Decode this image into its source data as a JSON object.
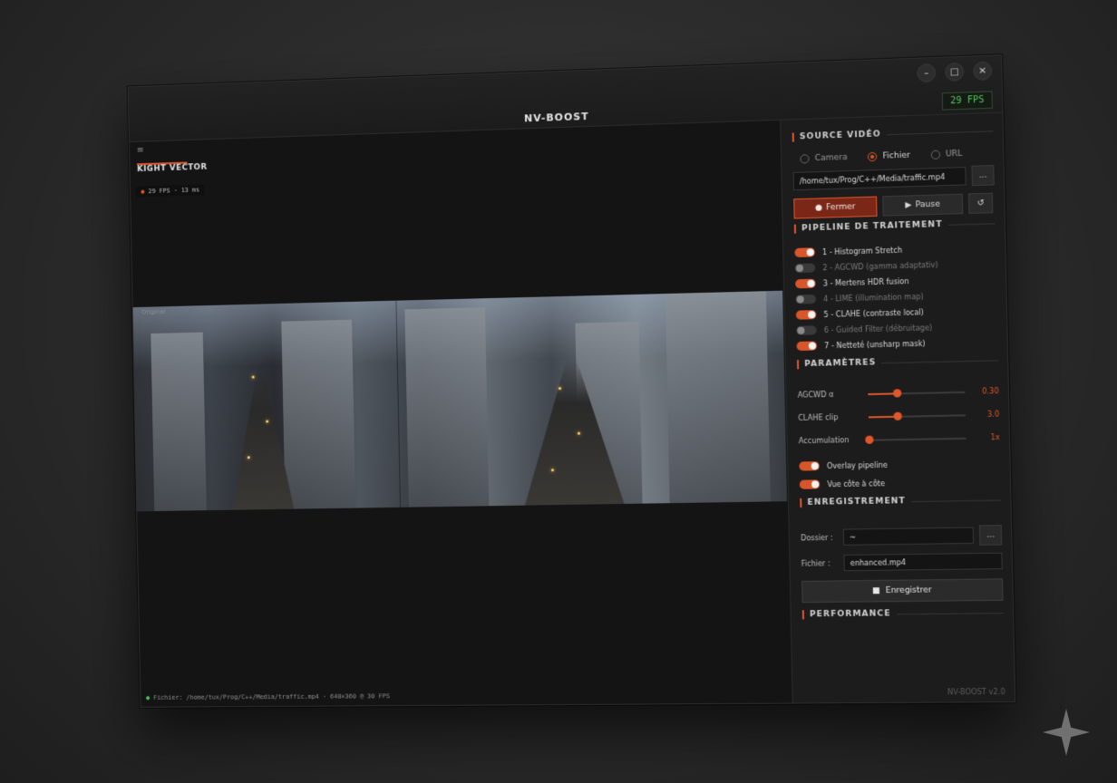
{
  "window": {
    "title": "NV-BOOST",
    "fps_badge": "29 FPS",
    "controls": {
      "minimize": "–",
      "maximize": "□",
      "close": "✕"
    }
  },
  "viewer": {
    "menu_icon": "≡",
    "brand": "KIGHT VECTOR",
    "mini_stats": {
      "dot": "●",
      "fps": "29 FPS",
      "sep": "·",
      "ms": "13 ms"
    },
    "overlay_label": "Original",
    "status_dot": "●",
    "status_text": "Fichier: /home/tux/Prog/C++/Media/traffic.mp4 · 640×360 @ 30 FPS"
  },
  "panel": {
    "source": {
      "title": "SOURCE VIDÉO",
      "radios": [
        {
          "label": "Camera",
          "selected": false
        },
        {
          "label": "Fichier",
          "selected": true
        },
        {
          "label": "URL",
          "selected": false
        }
      ],
      "path": "/home/tux/Prog/C++/Media/traffic.mp4",
      "browse": "...",
      "btn_close": "Fermer",
      "btn_close_icon": "●",
      "btn_pause": "Pause",
      "btn_pause_icon": "▶",
      "btn_reload_icon": "↺"
    },
    "pipeline": {
      "title": "PIPELINE DE TRAITEMENT",
      "items": [
        {
          "label": "1 - Histogram Stretch",
          "on": true
        },
        {
          "label": "2 - AGCWD (gamma adaptativ)",
          "on": false
        },
        {
          "label": "3 - Mertens HDR fusion",
          "on": true
        },
        {
          "label": "4 - LIME (illumination map)",
          "on": false
        },
        {
          "label": "5 - CLAHE (contraste local)",
          "on": true
        },
        {
          "label": "6 - Guided Filter (débruitage)",
          "on": false
        },
        {
          "label": "7 - Netteté (unsharp mask)",
          "on": true
        }
      ]
    },
    "params": {
      "title": "PARAMÈTRES",
      "sliders": [
        {
          "label": "AGCWD α",
          "value": "0.30",
          "fraction": 0.3
        },
        {
          "label": "CLAHE clip",
          "value": "3.0",
          "fraction": 0.3
        },
        {
          "label": "Accumulation",
          "value": "1x",
          "fraction": 0.0
        }
      ],
      "toggles": [
        {
          "label": "Overlay pipeline",
          "on": true
        },
        {
          "label": "Vue côte à côte",
          "on": true
        }
      ]
    },
    "record": {
      "title": "ENREGISTREMENT",
      "folder_label": "Dossier :",
      "folder_value": "~",
      "browse": "...",
      "file_label": "Fichier :",
      "file_value": "enhanced.mp4",
      "button": "Enregistrer",
      "button_icon": "■"
    },
    "performance": {
      "title": "PERFORMANCE"
    },
    "version": "NV-BOOST v2.0"
  },
  "colors": {
    "accent": "#d9552a",
    "fps_green": "#52c75c"
  }
}
